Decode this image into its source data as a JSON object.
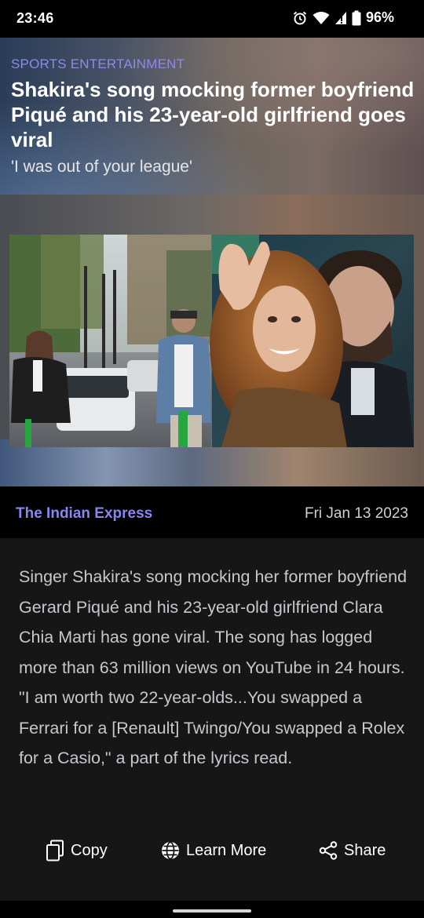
{
  "status_bar": {
    "time": "23:46",
    "battery": "96%",
    "icons": [
      "alarm-icon",
      "wifi-icon",
      "signal-icon",
      "battery-icon"
    ]
  },
  "article": {
    "category": "SPORTS ENTERTAINMENT",
    "headline": "Shakira's song mocking former boyfriend Piqué and his 23-year-old girlfriend goes viral",
    "subtitle": "'I was out of your league'",
    "source": "The Indian Express",
    "date": "Fri Jan 13 2023",
    "body": "Singer Shakira's song mocking her former boyfriend Gerard Piqué and his 23-year-old girlfriend Clara Chia Marti has gone viral. The song has logged more than 63 million views on YouTube in 24 hours. \"I am worth two 22-year-olds...You swapped a Ferrari for a [Renault] Twingo/You swapped a Rolex for a Casio,\" a part of the lyrics read."
  },
  "actions": {
    "copy": "Copy",
    "learn_more": "Learn More",
    "share": "Share"
  },
  "colors": {
    "accent": "#8a85f0",
    "background": "#161616",
    "source_bar": "#000000"
  }
}
